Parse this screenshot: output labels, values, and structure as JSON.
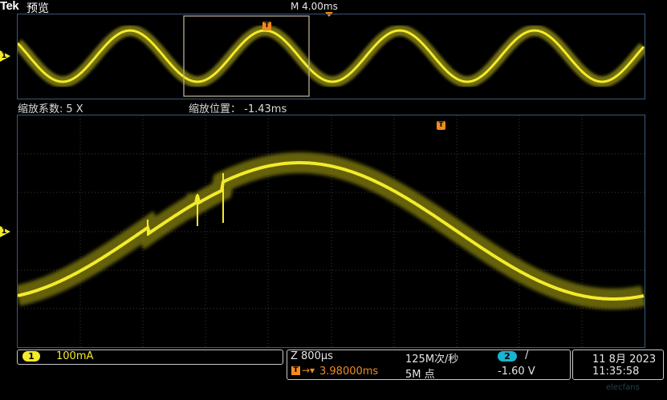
{
  "header": {
    "brand": "Tek",
    "mode": "预览",
    "timebase": "M 4.00ms"
  },
  "overview": {
    "channel_marker": "1",
    "trigger_marker": "T"
  },
  "zoom": {
    "factor_label": "缩放系数:",
    "factor_value": "5 X",
    "position_label": "缩放位置：",
    "position_value": "-1.43ms"
  },
  "main_plot": {
    "channel_marker": "1",
    "trigger_marker": "T"
  },
  "status": {
    "ch1": {
      "number": "1",
      "scale": "100mA"
    },
    "horizontal": {
      "zoom_scale": "Z 800µs",
      "sample_rate": "125M次/秒",
      "trigger_position": "3.98000ms",
      "record_length": "5M 点"
    },
    "trigger": {
      "source_number": "2",
      "slope_symbol": "/",
      "level": "-1.60 V"
    },
    "datetime": {
      "date": "11 8月 2023",
      "time": "11:35:58"
    }
  },
  "watermark": "elecfans",
  "colors": {
    "ch1": "#f3eb2a",
    "ch2": "#1ab4d2",
    "trigger": "#f08c1e",
    "graticule_border": "#3b5a78"
  },
  "icons": {
    "trigger_marker": "orange-T-flag",
    "trigger_slope": "rising-edge-slash",
    "trigger_position_arrow": "right-arrow-down-triangle"
  }
}
